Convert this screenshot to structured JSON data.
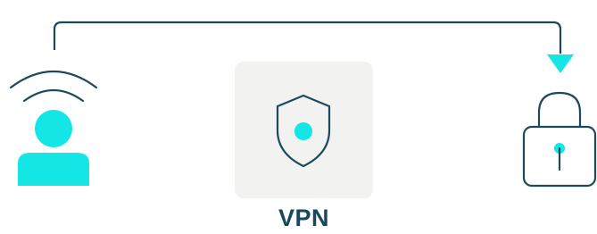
{
  "diagram": {
    "vpn_label": "VPN",
    "nodes": [
      {
        "id": "user",
        "icon": "user-broadcast-icon"
      },
      {
        "id": "vpn",
        "icon": "shield-icon"
      },
      {
        "id": "lock",
        "icon": "lock-icon"
      }
    ],
    "connector": {
      "from": "user",
      "to": "lock",
      "style": "arrow"
    }
  },
  "colors": {
    "accent": "#14e6e6",
    "stroke": "#1c4a5c",
    "box_bg": "#f2f2f1",
    "label": "#18485a"
  }
}
